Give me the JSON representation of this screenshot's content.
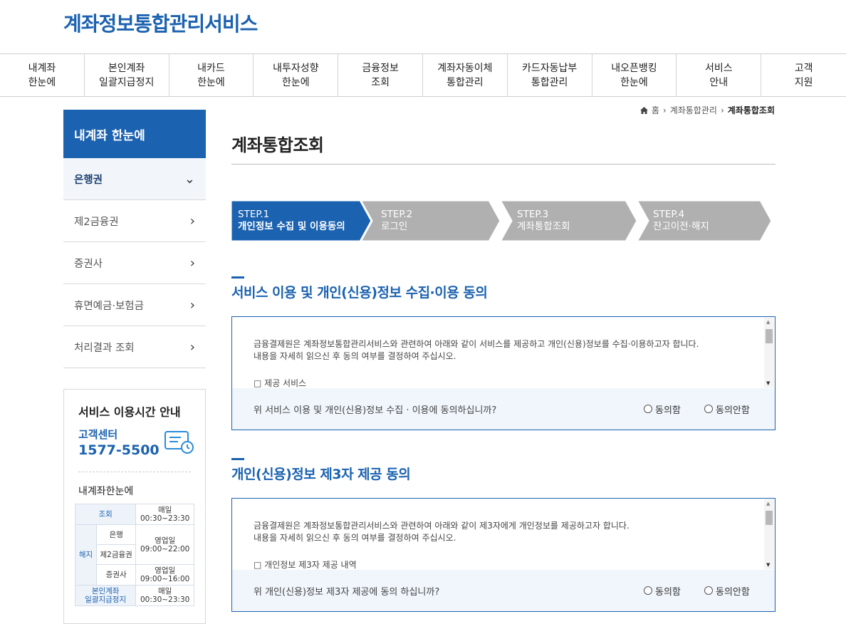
{
  "header": {
    "logo": "계좌정보통합관리서비스"
  },
  "gnb": [
    {
      "l1": "내계좌",
      "l2": "한눈에"
    },
    {
      "l1": "본인계좌",
      "l2": "일괄지급정지"
    },
    {
      "l1": "내카드",
      "l2": "한눈에"
    },
    {
      "l1": "내투자성향",
      "l2": "한눈에"
    },
    {
      "l1": "금융정보",
      "l2": "조회"
    },
    {
      "l1": "계좌자동이체",
      "l2": "통합관리"
    },
    {
      "l1": "카드자동납부",
      "l2": "통합관리"
    },
    {
      "l1": "내오픈뱅킹",
      "l2": "한눈에"
    },
    {
      "l1": "서비스",
      "l2": "안내"
    },
    {
      "l1": "고객",
      "l2": "지원"
    }
  ],
  "lnb": {
    "title": "내계좌 한눈에",
    "items": [
      {
        "label": "은행권"
      },
      {
        "label": "제2금융권"
      },
      {
        "label": "증권사"
      },
      {
        "label": "휴면예금·보험금"
      },
      {
        "label": "처리결과 조회"
      }
    ]
  },
  "service_hours": {
    "title": "서비스 이용시간 안내",
    "cc_label": "고객센터",
    "cc_phone": "1577-5500",
    "sub_title": "내계좌한눈에",
    "rows": {
      "inquiry": "조회",
      "inquiry_time1": "매일",
      "inquiry_time2": "00:30~23:30",
      "cancel": "해지",
      "bank": "은행",
      "bank_time1": "영업일",
      "bank_time2": "09:00~22:00",
      "second": "제2금융권",
      "sec": "증권사",
      "sec_time1": "영업일",
      "sec_time2": "09:00~16:00",
      "stop1": "본인계좌",
      "stop2": "일괄지급정지",
      "stop_time1": "매일",
      "stop_time2": "00:30~23:30"
    }
  },
  "breadcrumb": {
    "home": "홈",
    "level1": "계좌통합관리",
    "current": "계좌통합조회"
  },
  "page_title": "계좌통합조회",
  "steps": [
    {
      "num": "STEP.1",
      "label": "개인정보 수집 및 이용동의",
      "active": true
    },
    {
      "num": "STEP.2",
      "label": "로그인",
      "active": false
    },
    {
      "num": "STEP.3",
      "label": "계좌통합조회",
      "active": false
    },
    {
      "num": "STEP.4",
      "label": "잔고이전·해지",
      "active": false
    }
  ],
  "colors": {
    "primary": "#1b62b0",
    "step_inactive": "#b0b0b0"
  },
  "section1": {
    "title": "서비스 이용 및 개인(신용)정보 수집·이용 동의",
    "line1": "금융결제원은 계좌정보통합관리서비스와 관련하여 아래와 같이 서비스를 제공하고 개인(신용)정보를 수집·이용하고자 합니다.",
    "line2": "내용을 자세히 읽으신 후 동의 여부를 결정하여 주십시오.",
    "line3": "□ 제공 서비스",
    "question": "위 서비스 이용 및 개인(신용)정보 수집 · 이용에 동의하십니까?",
    "agree": "동의함",
    "disagree": "동의안함"
  },
  "section2": {
    "title": "개인(신용)정보 제3자 제공 동의",
    "line1": "금융결제원은 계좌정보통합관리서비스와 관련하여 아래와 같이 제3자에게 개인정보를 제공하고자 합니다.",
    "line2": "내용을 자세히 읽으신 후 동의 여부를 결정하여 주십시오.",
    "line3": "□ 개인정보 제3자 제공 내역",
    "question": "위 개인(신용)정보 제3자 제공에 동의 하십니까?",
    "agree": "동의함",
    "disagree": "동의안함"
  }
}
